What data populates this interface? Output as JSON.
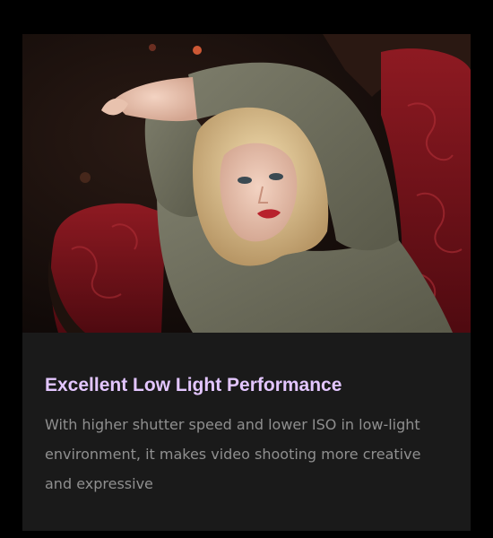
{
  "feature": {
    "title": "Excellent Low Light Performance",
    "description": "With higher shutter speed and lower ISO in low-light environment, it makes video shooting more creative and expressive"
  },
  "colors": {
    "title": "#e3c6ff",
    "description": "#8f8f8f",
    "card_background": "#1a1a1a",
    "page_background": "#000000"
  },
  "photo": {
    "subject": "woman-reclining-on-red-armchair"
  }
}
